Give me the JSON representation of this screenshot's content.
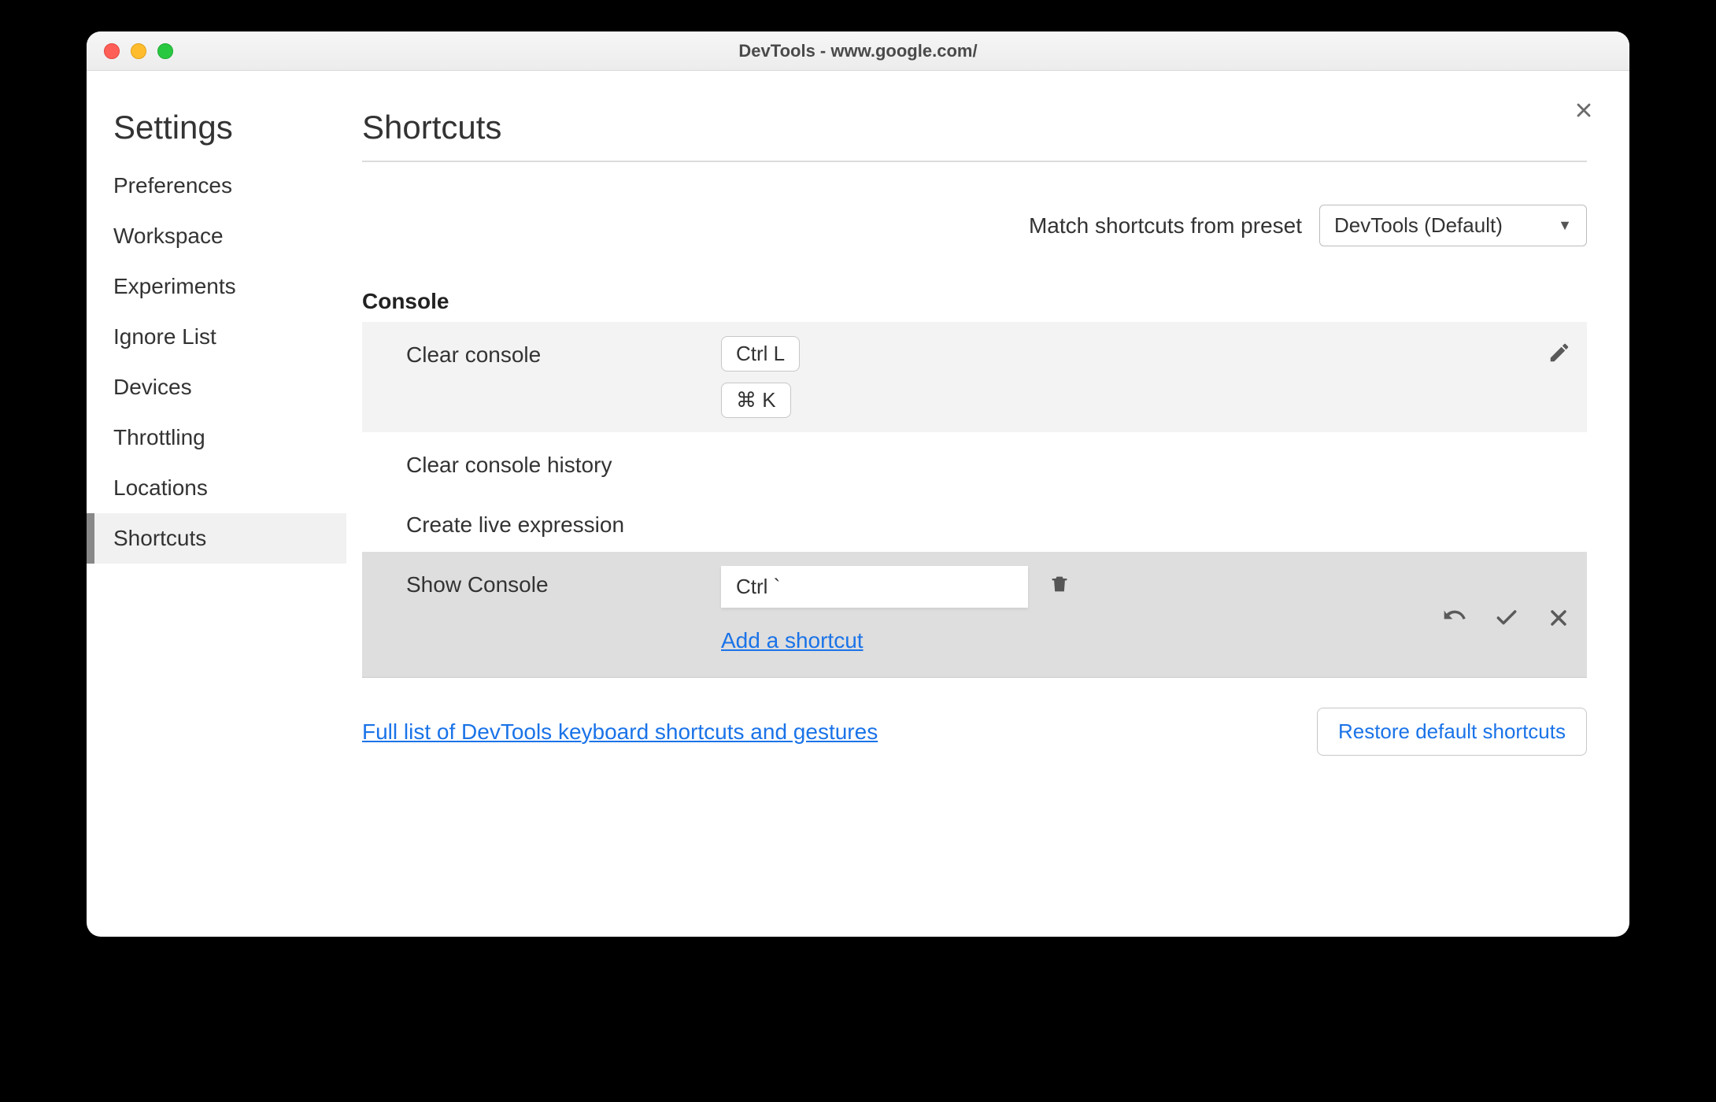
{
  "window": {
    "title": "DevTools - www.google.com/"
  },
  "sidebar": {
    "heading": "Settings",
    "items": [
      {
        "label": "Preferences"
      },
      {
        "label": "Workspace"
      },
      {
        "label": "Experiments"
      },
      {
        "label": "Ignore List"
      },
      {
        "label": "Devices"
      },
      {
        "label": "Throttling"
      },
      {
        "label": "Locations"
      },
      {
        "label": "Shortcuts"
      }
    ],
    "selected_index": 7
  },
  "page": {
    "title": "Shortcuts",
    "preset_label": "Match shortcuts from preset",
    "preset_value": "DevTools (Default)"
  },
  "section": {
    "title": "Console",
    "rows": [
      {
        "label": "Clear console",
        "keys": [
          "Ctrl L",
          "⌘ K"
        ]
      },
      {
        "label": "Clear console history",
        "keys": []
      },
      {
        "label": "Create live expression",
        "keys": []
      }
    ],
    "editing": {
      "label": "Show Console",
      "input_value": "Ctrl `",
      "add_link": "Add a shortcut"
    }
  },
  "footer": {
    "doc_link": "Full list of DevTools keyboard shortcuts and gestures",
    "restore": "Restore default shortcuts"
  }
}
